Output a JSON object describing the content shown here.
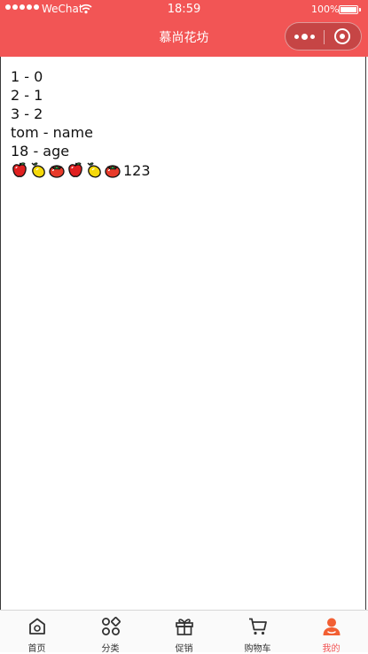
{
  "status_bar": {
    "carrier": "WeChat",
    "time": "18:59",
    "battery": "100%"
  },
  "nav": {
    "title": "慕尚花坊"
  },
  "lines": [
    "1 - 0",
    "2 - 1",
    "3 - 2",
    "tom - name",
    "18 - age"
  ],
  "fruit_row": {
    "items": [
      "apple",
      "lemon",
      "tomato",
      "apple",
      "lemon",
      "tomato"
    ],
    "suffix": "123"
  },
  "tabbar": {
    "active_index": 4,
    "active_color": "#f25555",
    "tabs": [
      {
        "label": "首页",
        "icon": "home-icon"
      },
      {
        "label": "分类",
        "icon": "category-icon"
      },
      {
        "label": "促销",
        "icon": "gift-icon"
      },
      {
        "label": "购物车",
        "icon": "cart-icon"
      },
      {
        "label": "我的",
        "icon": "user-icon"
      }
    ]
  },
  "colors": {
    "brand": "#f25555",
    "text": "#111111",
    "tab_text": "#333333"
  }
}
